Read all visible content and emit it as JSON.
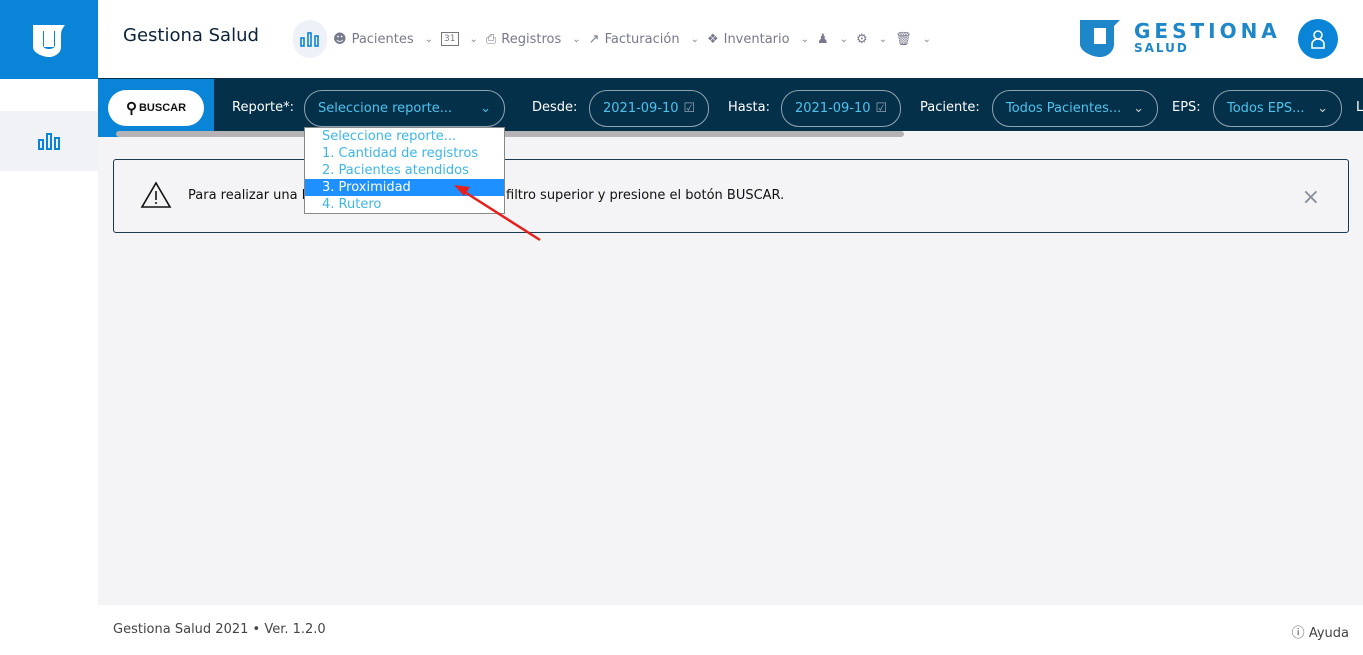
{
  "app": {
    "title": "Gestiona Salud"
  },
  "nav": {
    "items": [
      {
        "label": "Pacientes"
      },
      {
        "label": "Registros"
      },
      {
        "label": "Facturación"
      },
      {
        "label": "Inventario"
      }
    ],
    "calendar_day": "31"
  },
  "brand": {
    "line1": "GESTIONA",
    "line2": "SALUD"
  },
  "filters": {
    "buscar": "BUSCAR",
    "reporte_label": "Reporte*:",
    "reporte_value": "Seleccione reporte...",
    "desde_label": "Desde:",
    "desde_value": "2021-09-10",
    "hasta_label": "Hasta:",
    "hasta_value": "2021-09-10",
    "paciente_label": "Paciente:",
    "paciente_value": "Todos Pacientes...",
    "eps_label": "EPS:",
    "eps_value": "Todos EPS...",
    "cut_label": "L"
  },
  "dropdown": {
    "options": [
      "Seleccione reporte...",
      "1. Cantidad de registros",
      "2. Pacientes atendidos",
      "3. Proximidad",
      "4. Rutero"
    ],
    "selected": 3
  },
  "alert": {
    "text": "Para realizar una b",
    "text_end": "filtro superior y presione el botón BUSCAR."
  },
  "footer": {
    "version": "Gestiona Salud 2021 • Ver. 1.2.0",
    "help": "Ayuda"
  },
  "colors": {
    "primary": "#0a84d6",
    "navy": "#05304a",
    "accent_text": "#4fc3ec"
  }
}
